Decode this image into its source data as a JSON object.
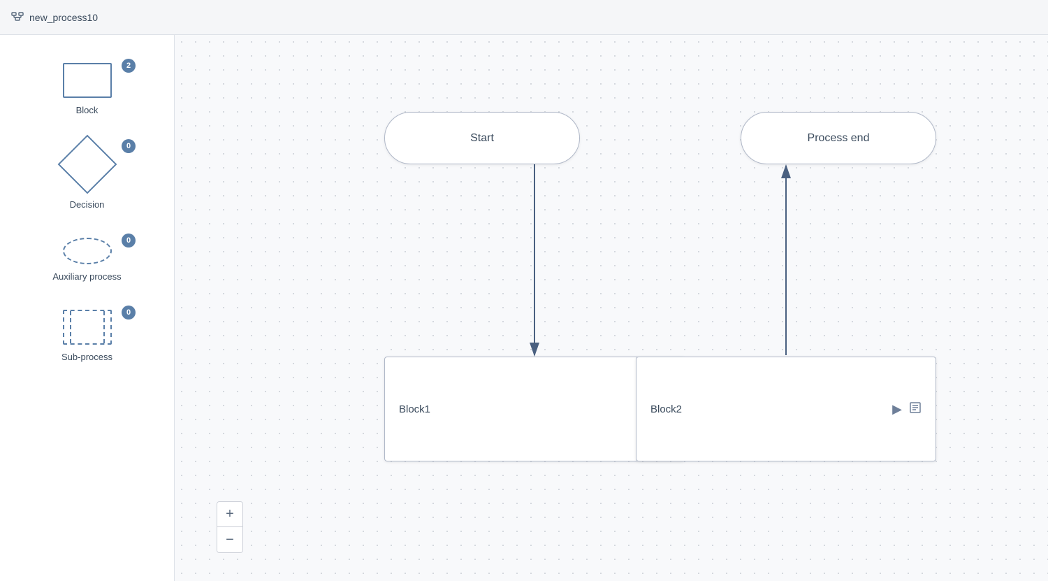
{
  "titleBar": {
    "icon": "⊞",
    "title": "new_process10"
  },
  "sidebar": {
    "items": [
      {
        "id": "block",
        "label": "Block",
        "shape": "block",
        "badge": "2"
      },
      {
        "id": "decision",
        "label": "Decision",
        "shape": "decision",
        "badge": "0"
      },
      {
        "id": "auxiliary",
        "label": "Auxiliary process",
        "shape": "auxiliary",
        "badge": "0"
      },
      {
        "id": "subprocess",
        "label": "Sub-process",
        "shape": "subprocess",
        "badge": "0"
      }
    ]
  },
  "canvas": {
    "nodes": {
      "start": {
        "label": "Start"
      },
      "processEnd": {
        "label": "Process end"
      },
      "block1": {
        "label": "Block1"
      },
      "block2": {
        "label": "Block2"
      }
    }
  },
  "zoom": {
    "plusLabel": "+",
    "minusLabel": "−"
  }
}
